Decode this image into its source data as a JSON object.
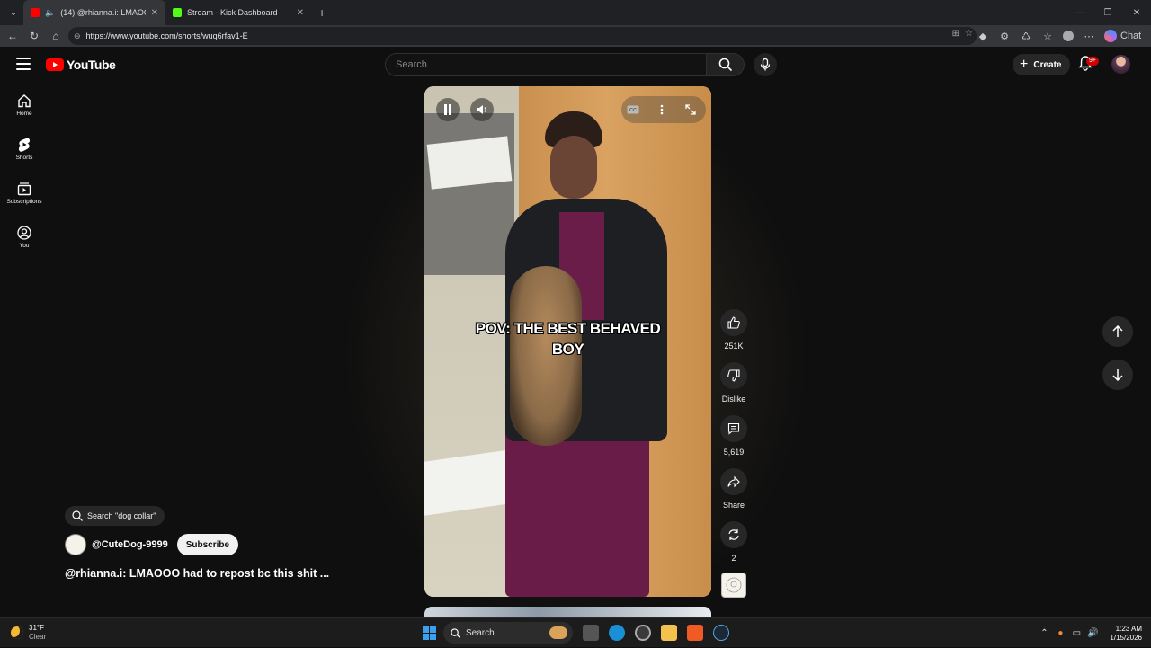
{
  "browser": {
    "tabs": [
      {
        "title": "(14) @rhianna.i: LMAOOO ha",
        "active": true
      },
      {
        "title": "Stream - Kick Dashboard",
        "active": false
      }
    ],
    "url": "https://www.youtube.com/shorts/wuq6rfav1-E",
    "chat_label": "Chat"
  },
  "header": {
    "logo_text": "YouTube",
    "search_placeholder": "Search",
    "create_label": "Create",
    "notification_count": "9+"
  },
  "sidebar": {
    "items": [
      {
        "label": "Home",
        "icon": "home-icon"
      },
      {
        "label": "Shorts",
        "icon": "shorts-icon"
      },
      {
        "label": "Subscriptions",
        "icon": "subscriptions-icon"
      },
      {
        "label": "You",
        "icon": "you-icon"
      }
    ]
  },
  "short": {
    "caption": "POV: THE BEST BEHAVED BOY",
    "search_suggestion": "Search \"dog collar\"",
    "channel": "@CuteDog-9999",
    "subscribe_label": "Subscribe",
    "title": "@rhianna.i: LMAOOO had to repost bc this shit ..."
  },
  "actions": {
    "likes": "251K",
    "dislike_label": "Dislike",
    "comments": "5,619",
    "share_label": "Share",
    "remix": "2"
  },
  "taskbar": {
    "temperature": "31°F",
    "condition": "Clear",
    "search_label": "Search",
    "time": "1:23 AM",
    "date": "1/15/2026"
  }
}
